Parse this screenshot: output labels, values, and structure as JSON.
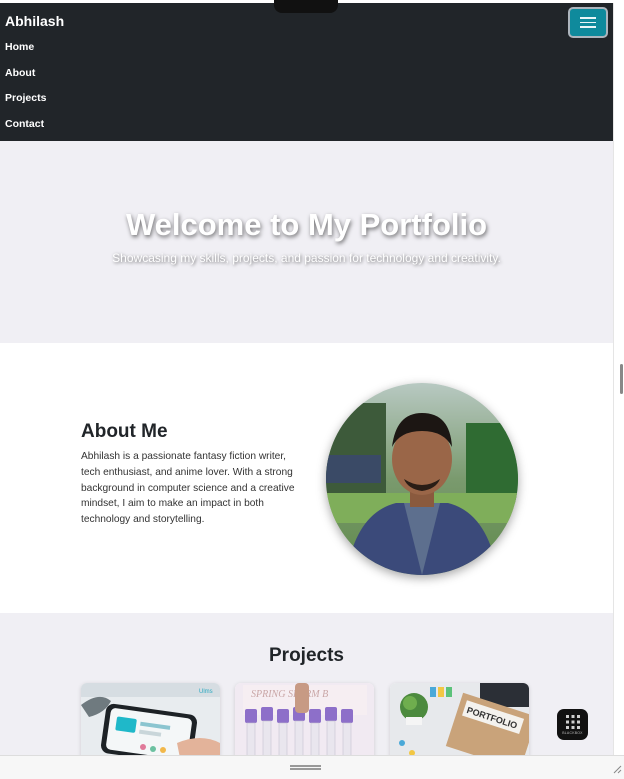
{
  "nav": {
    "brand": "Abhilash",
    "links": [
      "Home",
      "About",
      "Projects",
      "Contact"
    ]
  },
  "hero": {
    "title": "Welcome to My Portfolio",
    "subtitle": "Showcasing my skills, projects, and passion for technology and creativity."
  },
  "about": {
    "heading": "About Me",
    "text": "Abhilash is a passionate fantasy fiction writer, tech enthusiast, and anime lover. With a strong background in computer science and a creative mindset, I aim to make an impact in both technology and storytelling."
  },
  "projects": {
    "heading": "Projects",
    "cards": [
      {
        "image": "phone-app-image"
      },
      {
        "image": "test-tubes-image",
        "caption": "SPRING SPERM B"
      },
      {
        "image": "portfolio-folder-image",
        "caption": "PORTFOLIO"
      }
    ]
  },
  "floating_widget": {
    "label": "BLACKBOX"
  },
  "colors": {
    "navbar": "#212529",
    "toggler": "#0f8a9c",
    "page_bg": "#f0eff4"
  }
}
